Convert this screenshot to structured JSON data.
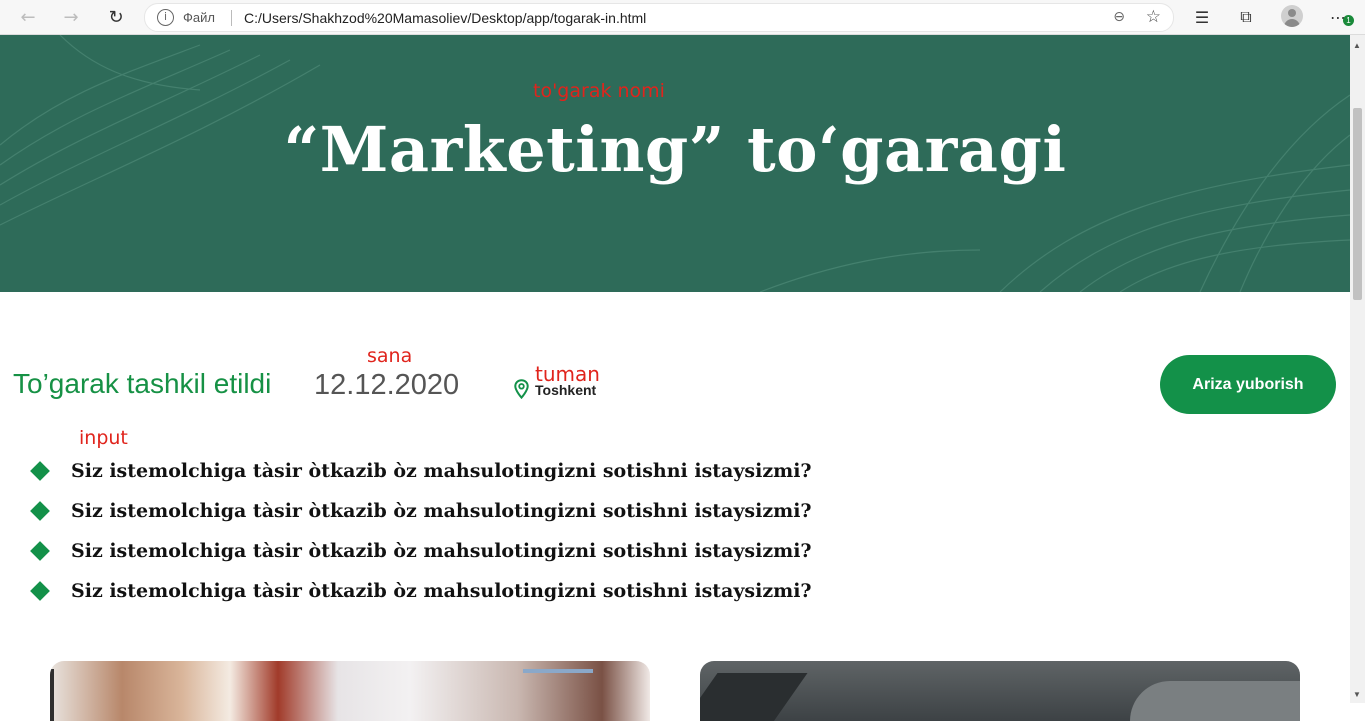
{
  "browser": {
    "back_icon": "arrow-left-icon",
    "forward_icon": "arrow-right-icon",
    "reload_icon": "reload-icon",
    "scheme_label": "Файл",
    "url": "C:/Users/Shakhzod%20Mamasoliev/Desktop/app/togarak-in.html",
    "icons": [
      "info-icon",
      "zoom-out-icon",
      "add-favorite-icon",
      "favorites-icon",
      "collections-icon",
      "profile-icon",
      "more-icon"
    ],
    "update_badge": "1"
  },
  "hero": {
    "note": "to'garak nomi",
    "title": "“Marketing” to‘garagi",
    "background": "#2e6b59"
  },
  "info": {
    "label": "To’garak tashkil etildi",
    "sana_note": "sana",
    "date": "12.12.2020",
    "tuman_note": "tuman",
    "location": "Toshkent",
    "location_icon": "map-pin-icon",
    "accent": "#139149"
  },
  "apply_button": {
    "label": "Ariza yuborish"
  },
  "list": {
    "input_note": "input",
    "items": [
      "Siz istemolchiga tàsir òtkazib òz mahsulotingizni sotishni istaysizmi?",
      "Siz istemolchiga tàsir òtkazib òz mahsulotingizni sotishni istaysizmi?",
      "Siz istemolchiga tàsir òtkazib òz mahsulotingizni sotishni istaysizmi?",
      "Siz istemolchiga tàsir òtkazib òz mahsulotingizni sotishni istaysizmi?"
    ]
  },
  "annotation_color": "#e0241c"
}
